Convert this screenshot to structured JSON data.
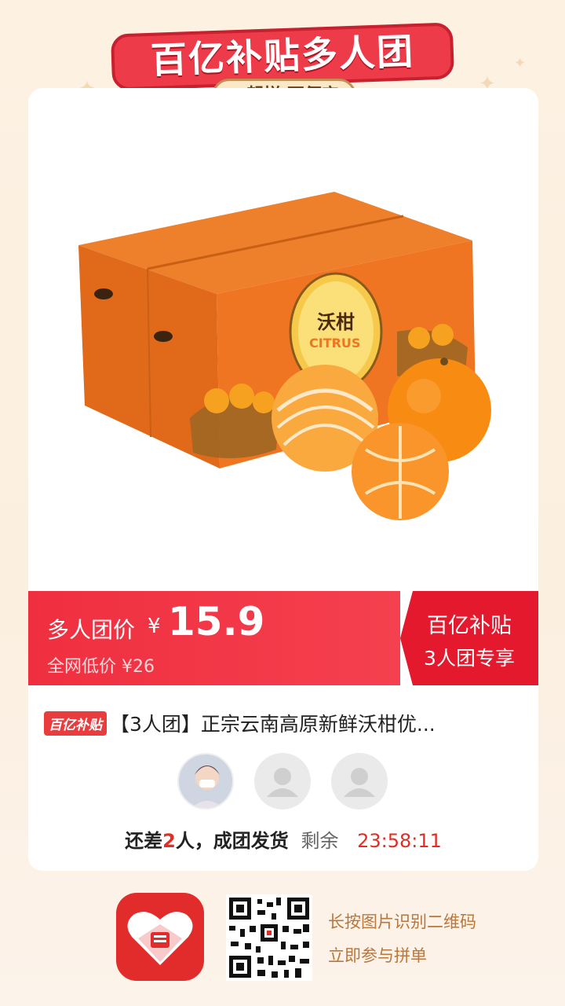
{
  "banner": {
    "title": "百亿补贴多人团",
    "subtitle": "一起拼 更便宜"
  },
  "product": {
    "image_icon": "citrus-box-image",
    "box_label": "沃柑",
    "box_label_en": "CITRUS"
  },
  "price": {
    "group_label": "多人团价",
    "currency": "¥",
    "group_price": "15.9",
    "market_label": "全网低价 ¥26",
    "promo_line1": "百亿补贴",
    "promo_line2": "3人团专享"
  },
  "listing": {
    "badge": "百亿补贴",
    "title": "【3人团】正宗云南高原新鲜沃柑优..."
  },
  "group": {
    "status_prefix": "还差",
    "missing_count": "2",
    "status_suffix": "人，成团发货",
    "remain_label": "剩余",
    "countdown": "23:58:11"
  },
  "footer": {
    "logo_icon": "pinduoduo-logo-icon",
    "qr_icon": "qr-code-icon",
    "line1": "长按图片识别二维码",
    "line2": "立即参与拼单"
  },
  "colors": {
    "accent_red": "#ef2f40",
    "deep_red": "#e4192d",
    "countdown_red": "#e02e24",
    "footer_text": "#b8773c",
    "background": "#fdf1e2"
  }
}
